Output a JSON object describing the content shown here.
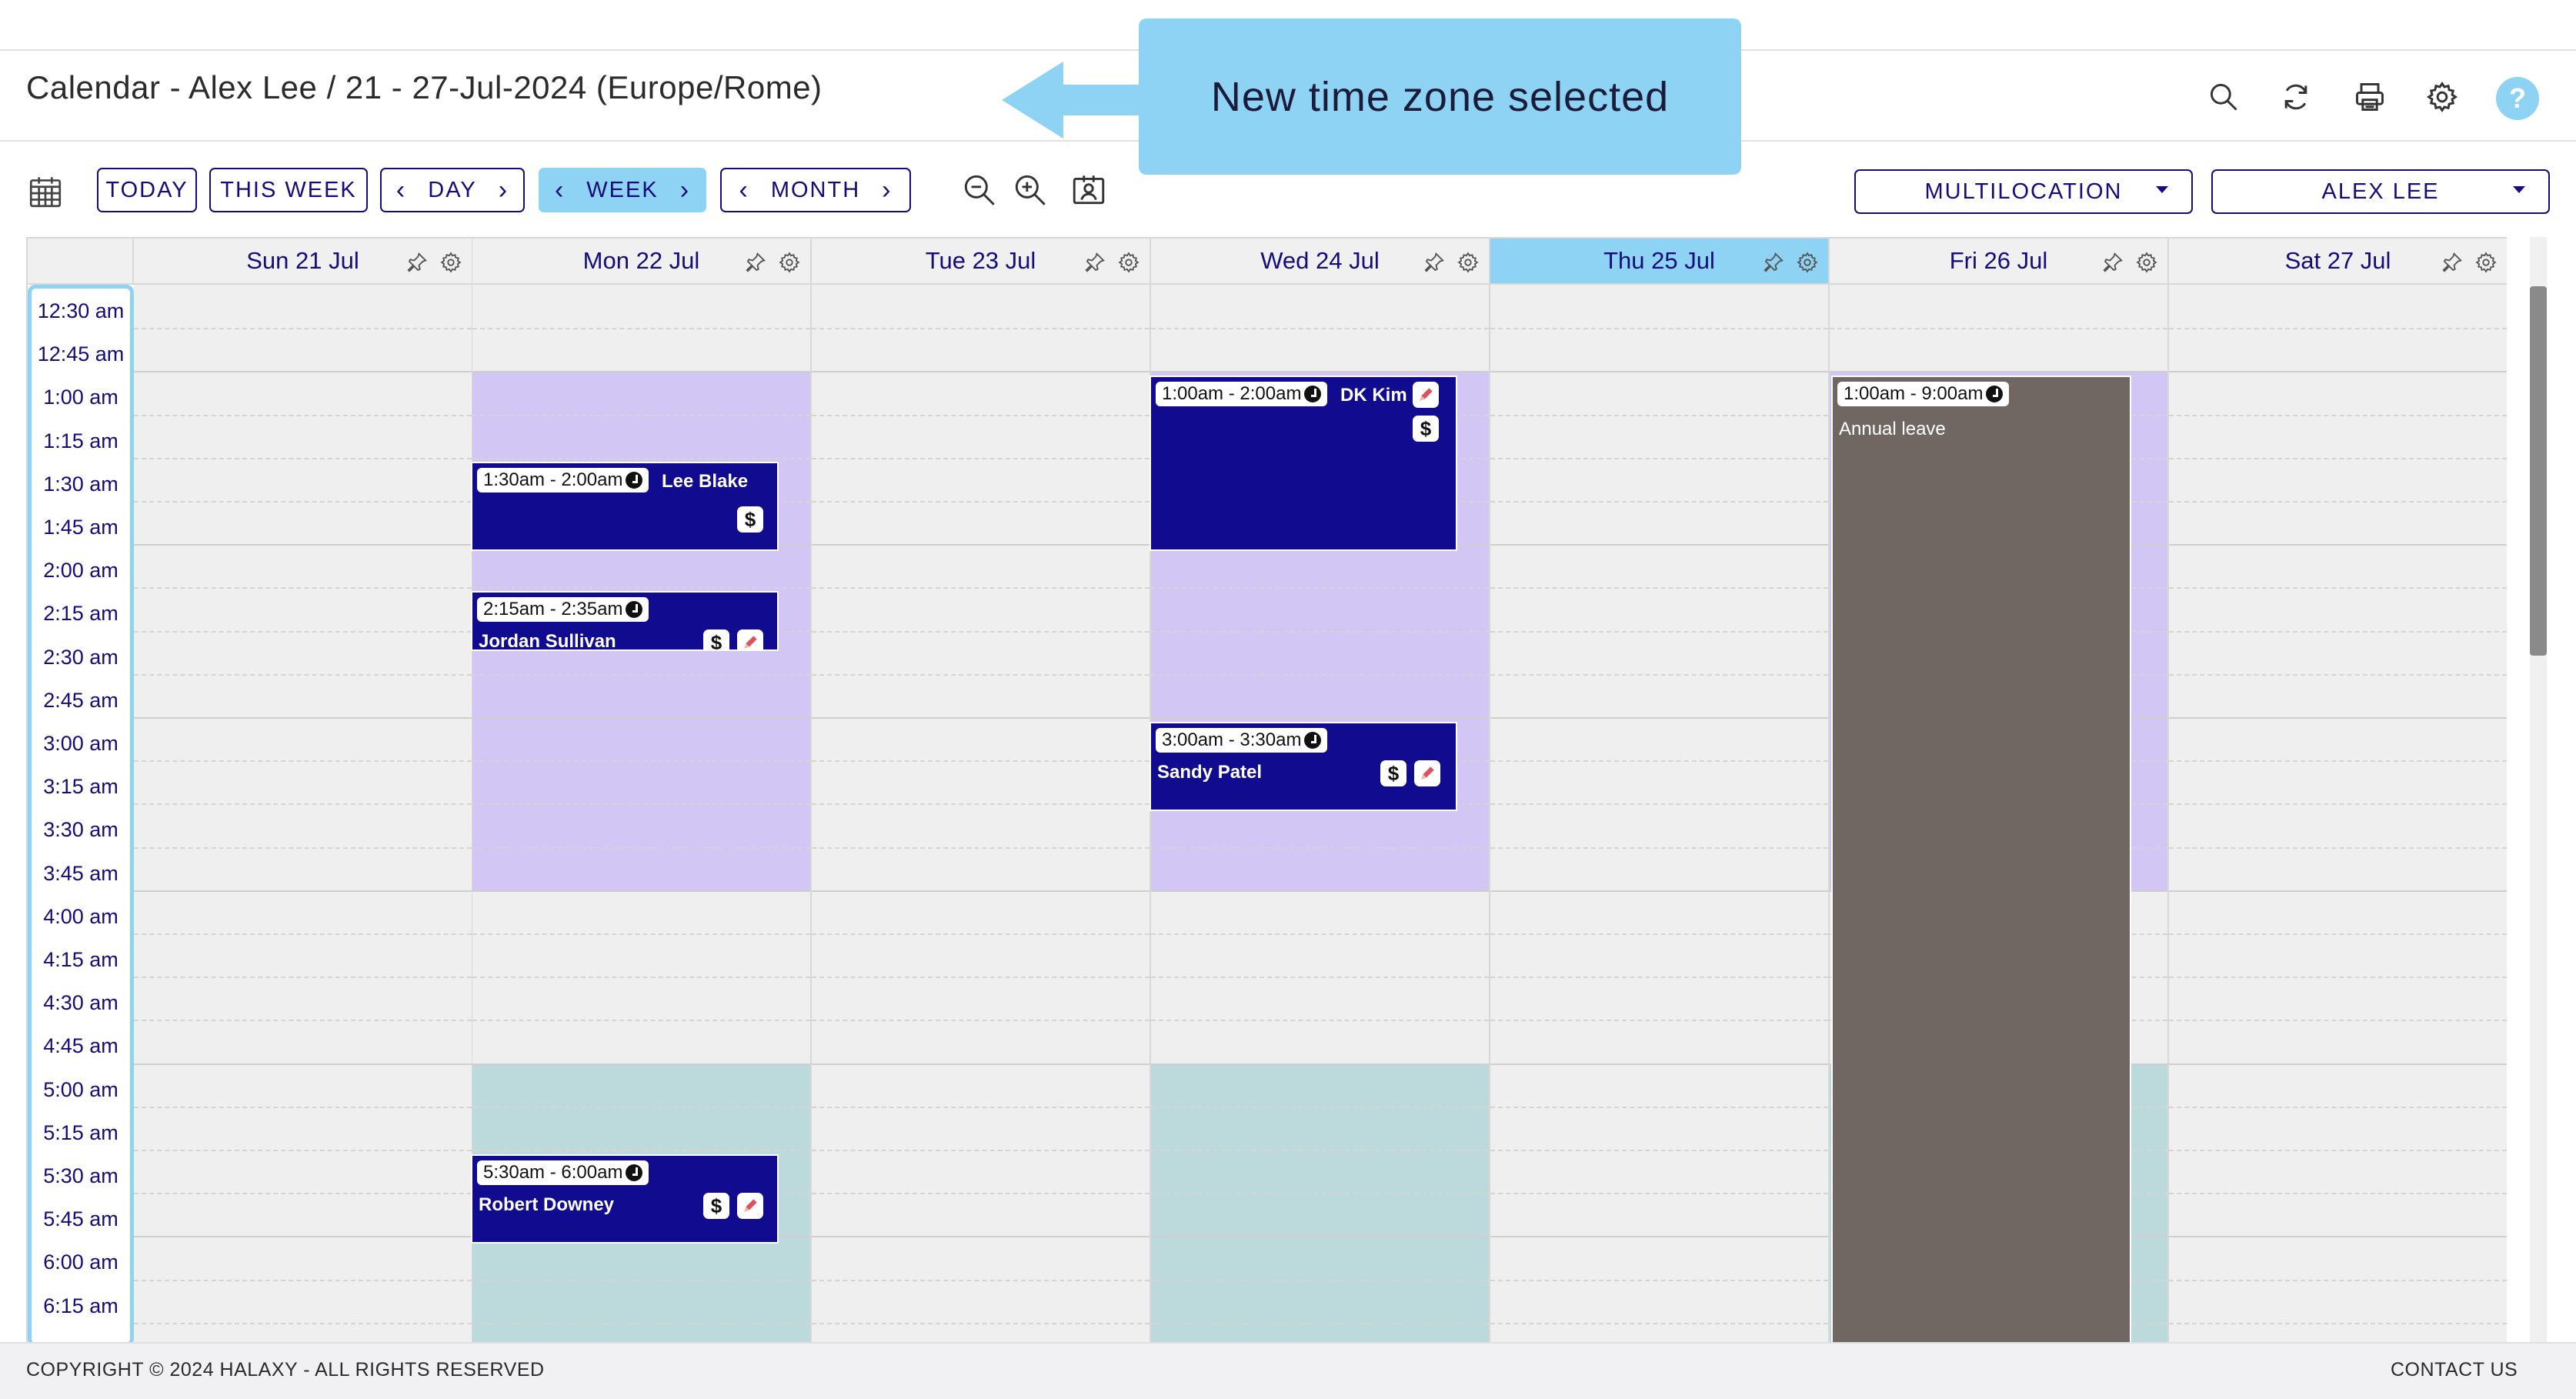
{
  "header": {
    "title": "Calendar - Alex Lee / 21 - 27-Jul-2024 (Europe/Rome)",
    "icons": [
      "search-icon",
      "refresh-icon",
      "print-icon",
      "gear-icon",
      "help-icon"
    ],
    "help_glyph": "?"
  },
  "callout": {
    "text": "New time zone selected"
  },
  "toolbar": {
    "today": "TODAY",
    "this_week": "THIS WEEK",
    "day": "DAY",
    "week": "WEEK",
    "month": "MONTH",
    "location_select": "MULTILOCATION",
    "practitioner_select": "ALEX LEE"
  },
  "days": [
    {
      "label": "Sun 21 Jul",
      "today": false
    },
    {
      "label": "Mon 22 Jul",
      "today": false
    },
    {
      "label": "Tue 23 Jul",
      "today": false
    },
    {
      "label": "Wed 24 Jul",
      "today": false
    },
    {
      "label": "Thu 25 Jul",
      "today": true
    },
    {
      "label": "Fri 26 Jul",
      "today": false
    },
    {
      "label": "Sat 27 Jul",
      "today": false
    }
  ],
  "times": [
    "12:30 am",
    "12:45 am",
    "1:00 am",
    "1:15 am",
    "1:30 am",
    "1:45 am",
    "2:00 am",
    "2:15 am",
    "2:30 am",
    "2:45 am",
    "3:00 am",
    "3:15 am",
    "3:30 am",
    "3:45 am",
    "4:00 am",
    "4:15 am",
    "4:30 am",
    "4:45 am",
    "5:00 am",
    "5:15 am",
    "5:30 am",
    "5:45 am",
    "6:00 am",
    "6:15 am"
  ],
  "appointments": [
    {
      "day": "Mon 22 Jul",
      "time": "1:30am - 2:00am",
      "name": "Lee Blake",
      "badges": [
        "$"
      ]
    },
    {
      "day": "Mon 22 Jul",
      "time": "2:15am - 2:35am",
      "name": "Jordan Sullivan",
      "badges": [
        "$",
        "edit"
      ]
    },
    {
      "day": "Mon 22 Jul",
      "time": "5:30am - 6:00am",
      "name": "Robert Downey",
      "badges": [
        "$",
        "edit"
      ]
    },
    {
      "day": "Wed 24 Jul",
      "time": "1:00am - 2:00am",
      "name": "DK Kim",
      "badges": [
        "edit",
        "$"
      ]
    },
    {
      "day": "Wed 24 Jul",
      "time": "3:00am - 3:30am",
      "name": "Sandy Patel",
      "badges": [
        "$",
        "edit"
      ]
    }
  ],
  "leave": {
    "day": "Fri 26 Jul",
    "time": "1:00am - 9:00am",
    "label": "Annual leave"
  },
  "colors": {
    "accent": "#8fd3f4",
    "navy": "#140c7a",
    "appointment": "#110b8f",
    "availability_purple": "#d2c6f5",
    "availability_teal": "#bcd9db",
    "leave": "#716762"
  },
  "footer": {
    "copyright": "COPYRIGHT © 2024 HALAXY - ALL RIGHTS RESERVED",
    "contact": "CONTACT US"
  }
}
